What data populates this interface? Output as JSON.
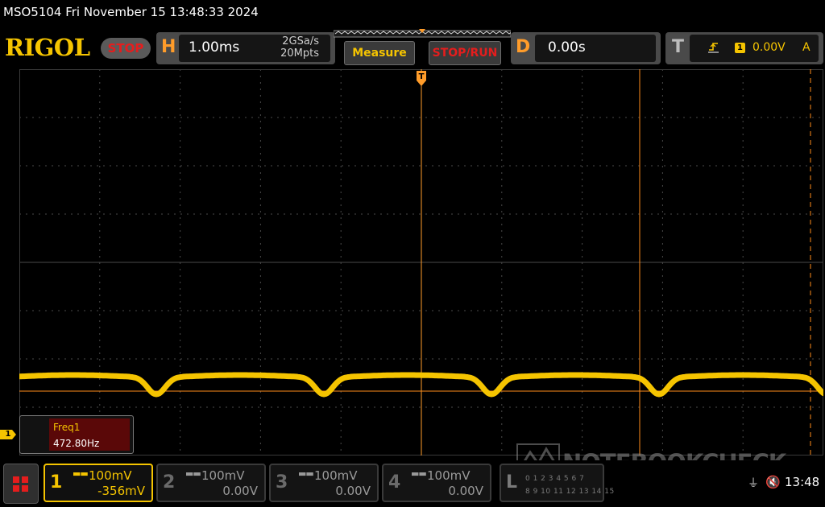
{
  "title_bar": {
    "text": "MSO5104  Fri November 15 13:48:33 2024"
  },
  "brand": {
    "logo": "RIGOL",
    "run_state": "STOP"
  },
  "horizontal": {
    "letter": "H",
    "timebase": "1.00ms",
    "sample_rate": "2GSa/s",
    "memory_depth": "20Mpts"
  },
  "buttons": {
    "measure": "Measure",
    "stop_run": "STOP/RUN"
  },
  "delay": {
    "letter": "D",
    "value": "0.00s"
  },
  "trigger": {
    "letter": "T",
    "slope_icon": "rising-edge-icon",
    "source": "1",
    "level": "0.00V",
    "mode": "A"
  },
  "measurement": {
    "label": "Freq1",
    "value": "472.80Hz"
  },
  "channel_marker": {
    "label": "1"
  },
  "channels": [
    {
      "num": "1",
      "coupling_icon": "dc-coupling-icon",
      "scale": "100mV",
      "offset": "-356mV",
      "active": true
    },
    {
      "num": "2",
      "coupling_icon": "dc-coupling-icon",
      "scale": "100mV",
      "offset": "0.00V",
      "active": false
    },
    {
      "num": "3",
      "coupling_icon": "dc-coupling-icon",
      "scale": "100mV",
      "offset": "0.00V",
      "active": false
    },
    {
      "num": "4",
      "coupling_icon": "dc-coupling-icon",
      "scale": "100mV",
      "offset": "0.00V",
      "active": false
    }
  ],
  "logic": {
    "letter": "L",
    "row1": "0 1 2 3 4 5 6 7",
    "row2": "8 9 10 11 12 13 14 15"
  },
  "status": {
    "usb_icon": "usb-icon",
    "speaker_icon": "speaker-muted-icon",
    "clock": "13:48"
  },
  "watermark": {
    "text": "NOTEBOOKCHECK"
  },
  "colors": {
    "ch1": "#f5c400",
    "trigger_orange": "#ff9c2a",
    "stop_red": "#e51d1d",
    "background": "#000000"
  }
}
